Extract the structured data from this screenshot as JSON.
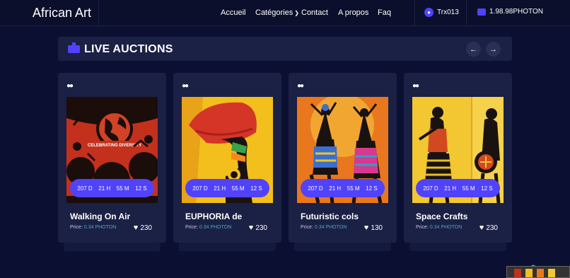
{
  "header": {
    "brand": "African Art",
    "nav": {
      "accueil": "Accueil",
      "categories": "Catégories",
      "contact": "Contact",
      "apropos": "A propos",
      "faq": "Faq"
    },
    "user": "Trx013",
    "wallet": "1.98.98PHOTON"
  },
  "section": {
    "title": "LIVE AUCTIONS",
    "prev": "←",
    "next": "→"
  },
  "cards": [
    {
      "title": "Walking On Air",
      "price_label": "Price:",
      "price": "0.34 PHOTON",
      "likes": "230",
      "timer": {
        "d": "207 D",
        "h": "21 H",
        "m": "55 M",
        "s": "12 S"
      }
    },
    {
      "title": "EUPHORIA de",
      "price_label": "Price:",
      "price": "0.34 PHOTON",
      "likes": "230",
      "timer": {
        "d": "207 D",
        "h": "21 H",
        "m": "55 M",
        "s": "12 S"
      }
    },
    {
      "title": "Futuristic cols",
      "price_label": "Price:",
      "price": "0.34 PHOTON",
      "likes": "130",
      "timer": {
        "d": "207 D",
        "h": "21 H",
        "m": "55 M",
        "s": "12 S"
      }
    },
    {
      "title": "Space Crafts",
      "price_label": "Price:",
      "price": "0.34 PHOTON",
      "likes": "230",
      "timer": {
        "d": "207 D",
        "h": "21 H",
        "m": "55 M",
        "s": "12 S"
      }
    }
  ],
  "art_text": "CELEBRATING DIVERSITY",
  "colors": {
    "accent": "#5142fc",
    "background": "#0b1033",
    "card": "#1b2045",
    "price": "#47a7c9"
  }
}
